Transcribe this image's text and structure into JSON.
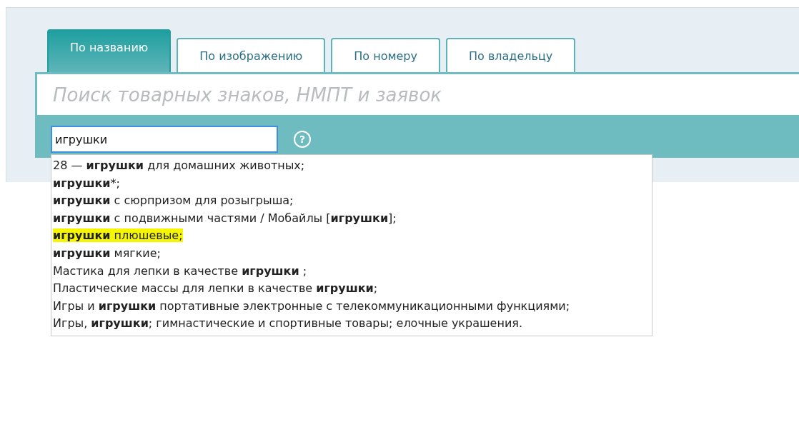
{
  "tabs": [
    {
      "label": "По названию",
      "selected": true
    },
    {
      "label": "По изображению",
      "selected": false
    },
    {
      "label": "По номеру",
      "selected": false
    },
    {
      "label": "По владельцу",
      "selected": false
    }
  ],
  "search": {
    "placeholder": "Поиск товарных знаков, НМПТ и заявок"
  },
  "query": {
    "value": "игрушки",
    "help": "?"
  },
  "suggestions": [
    {
      "text": "28 — **игрушки** для домашних животных;",
      "selected": false
    },
    {
      "text": "**игрушки***;",
      "selected": false
    },
    {
      "text": "**игрушки** с сюрпризом для розыгрыша;",
      "selected": false
    },
    {
      "text": "**игрушки** с подвижными частями / Мобайлы [**игрушки**];",
      "selected": false
    },
    {
      "text": "**игрушки** плюшевые;",
      "selected": true
    },
    {
      "text": "**игрушки** мягкие;",
      "selected": false
    },
    {
      "text": "Мастика для лепки в качестве **игрушки** ;",
      "selected": false
    },
    {
      "text": "Пластические массы для лепки в качестве **игрушки**;",
      "selected": false
    },
    {
      "text": "Игры и **игрушки** портативные электронные с телекоммуникационными функциями;",
      "selected": false
    },
    {
      "text": "Игры, **игрушки**; гимнастические и спортивные товары; елочные украшения.",
      "selected": false
    }
  ]
}
